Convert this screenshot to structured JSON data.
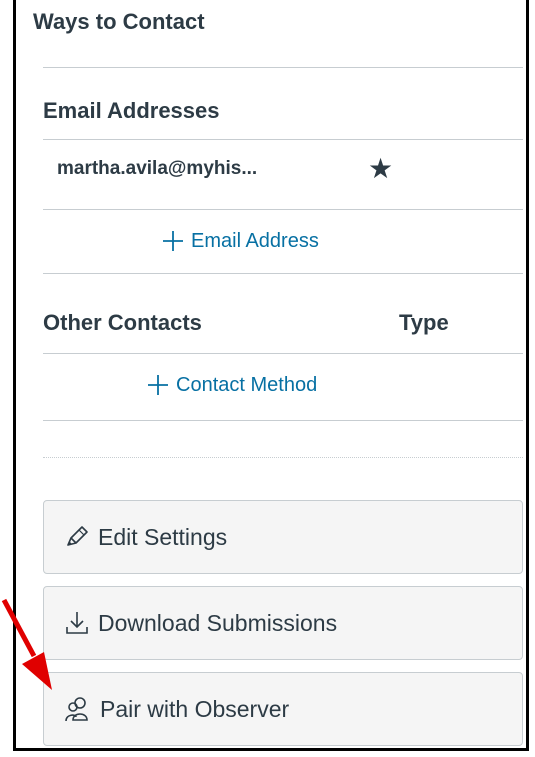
{
  "panel": {
    "title": "Ways to Contact"
  },
  "email_section": {
    "heading": "Email Addresses",
    "addresses": [
      {
        "address": "martha.avila@myhis...",
        "default_icon": "star-icon"
      }
    ],
    "add_label": "Email Address"
  },
  "contacts_section": {
    "heading": "Other Contacts",
    "type_heading": "Type",
    "add_label": "Contact Method"
  },
  "actions": {
    "edit_settings": {
      "label": "Edit Settings",
      "icon": "pencil-icon"
    },
    "download_submissions": {
      "label": "Download Submissions",
      "icon": "download-icon"
    },
    "pair_with_observer": {
      "label": "Pair with Observer",
      "icon": "observer-pair-icon"
    }
  },
  "colors": {
    "text": "#2d3b45",
    "link": "#0770a3",
    "button_bg": "#f5f5f5",
    "border": "#c7cdd1",
    "annotation_arrow": "#e00000"
  }
}
